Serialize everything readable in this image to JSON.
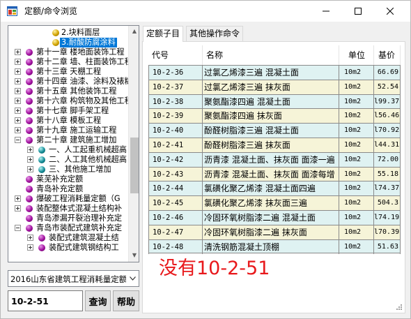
{
  "window": {
    "title": "定额/命令浏览",
    "icon": "app-icon"
  },
  "tree": {
    "top_items": [
      {
        "label": "2.块料面层",
        "icon": "gold-ball-icon",
        "selected": false
      },
      {
        "label": "3.耐酸防腐涂料",
        "icon": "gold-ball-icon",
        "selected": true
      }
    ],
    "chapters": [
      {
        "label": "第十一章 楼地面装饰工程",
        "expanded": false
      },
      {
        "label": "第十二章 墙、柱面装饰工程",
        "expanded": false
      },
      {
        "label": "第十三章 天棚工程",
        "expanded": false
      },
      {
        "label": "第十四章 油漆、涂料及裱糊工程",
        "expanded": false
      },
      {
        "label": "第十五章 其他装饰工程",
        "expanded": false
      },
      {
        "label": "第十六章 构筑物及其他工程",
        "expanded": false
      },
      {
        "label": "第十七章 脚手架工程",
        "expanded": false
      },
      {
        "label": "第十八章 模板工程",
        "expanded": false
      },
      {
        "label": "第十九章 施工运输工程",
        "expanded": false
      },
      {
        "label": "第二十章 建筑施工增加",
        "expanded": true
      }
    ],
    "chapter20_children": [
      {
        "label": "一、人工起重机械超高"
      },
      {
        "label": "二、人工其他机械超高"
      },
      {
        "label": "三、其他施工增加"
      }
    ],
    "supplements": [
      {
        "label": "莱芜补充定额",
        "expand": "none"
      },
      {
        "label": "青岛补充定额",
        "expand": "none"
      },
      {
        "label": "爆破工程消耗量定额（G",
        "expand": "plus"
      },
      {
        "label": "装配整体式混凝土结构补",
        "expand": "plus"
      },
      {
        "label": "青岛渗漏开裂治理补充定",
        "expand": "none"
      },
      {
        "label": "青岛市装配式建筑补充定",
        "expand": "minus"
      }
    ],
    "qingdao_children": [
      {
        "label": "装配式建筑混凝土结"
      },
      {
        "label": "装配式建筑钢结构工"
      }
    ]
  },
  "quota_combo": {
    "value": "2016山东省建筑工程消耗量定额"
  },
  "search": {
    "value": "10-2-51",
    "query_label": "查询",
    "help_label": "帮助"
  },
  "tabs": [
    {
      "label": "定额子目",
      "active": true
    },
    {
      "label": "其他操作命令",
      "active": false
    }
  ],
  "table": {
    "headers": {
      "code": "代号",
      "name": "名称",
      "unit": "单位",
      "price": "基价"
    },
    "rows": [
      {
        "code": "10-2-36",
        "name": "过氯乙烯漆三遍 混凝土面",
        "unit": "10m2",
        "price": "66.69",
        "bg": "#dff2f2"
      },
      {
        "code": "10-2-37",
        "name": "过氯乙烯漆三遍 抹灰面",
        "unit": "10m2",
        "price": "52.54",
        "bg": "#f6f4d8"
      },
      {
        "code": "10-2-38",
        "name": "聚氨酯漆四遍 混凝土面",
        "unit": "10m2",
        "price": "l99.37",
        "bg": "#dff2f2"
      },
      {
        "code": "10-2-39",
        "name": "聚氨酯漆四遍 抹灰面",
        "unit": "10m2",
        "price": "l56.46",
        "bg": "#f6f4d8"
      },
      {
        "code": "10-2-40",
        "name": "酚醛树脂漆三遍 混凝土面",
        "unit": "10m2",
        "price": "l70.92",
        "bg": "#dff2f2"
      },
      {
        "code": "10-2-41",
        "name": "酚醛树脂漆三遍 抹灰面",
        "unit": "10m2",
        "price": "l44.31",
        "bg": "#f6f4d8"
      },
      {
        "code": "10-2-42",
        "name": "沥青漆 混凝土面、抹灰面 面漆一遍",
        "unit": "10m2",
        "price": "72.00",
        "bg": "#dff2f2"
      },
      {
        "code": "10-2-43",
        "name": "沥青漆 混凝土面、抹灰面 面漆每增",
        "unit": "10m2",
        "price": "55.18",
        "bg": "#f6f4d8"
      },
      {
        "code": "10-2-44",
        "name": "氯磺化聚乙烯漆 混凝土面四遍",
        "unit": "10m2",
        "price": "l74.37",
        "bg": "#dff2f2"
      },
      {
        "code": "10-2-45",
        "name": "氯磺化聚乙烯漆 抹灰面三遍",
        "unit": "10m2",
        "price": "504.3",
        "bg": "#f6f4d8"
      },
      {
        "code": "10-2-46",
        "name": "冷固环氧树脂漆二遍 混凝土面",
        "unit": "10m2",
        "price": "l74.19",
        "bg": "#dff2f2"
      },
      {
        "code": "10-2-47",
        "name": "冷固环氧树脂漆二遍 抹灰面",
        "unit": "10m2",
        "price": "l70.39",
        "bg": "#f6f4d8"
      },
      {
        "code": "10-2-48",
        "name": "清洗钢筋混凝土顶棚",
        "unit": "10m2",
        "price": "51.63",
        "bg": "#dff2f2"
      }
    ]
  },
  "annotation": {
    "text": "没有10-2-51",
    "color": "#e8191c"
  }
}
